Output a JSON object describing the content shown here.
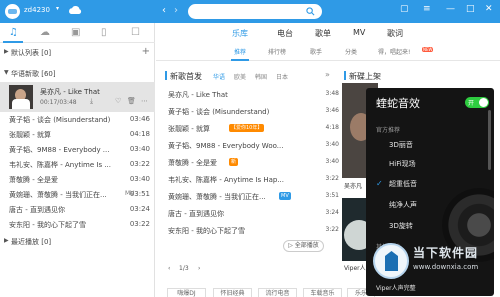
{
  "titlebar": {
    "username": "zd4230",
    "search_placeholder": "",
    "minimize": "—",
    "maximize": "□",
    "close": "✕",
    "skin": "▢",
    "menu": "≡"
  },
  "sidebar": {
    "tab_icons": [
      "music-note",
      "cloud",
      "device",
      "mobile",
      "phone"
    ],
    "groups": {
      "default_list": "默认列表 [0]",
      "hua_yu": "华语新歌 [60]",
      "recent": "最近播放 [0]"
    },
    "now_playing": {
      "title": "吴亦凡 - Like That",
      "time": "00:17/03:48"
    },
    "songs": [
      {
        "name": "黄子韬 - 谈会 (Misunderstand)",
        "duration": "03:46",
        "mv": ""
      },
      {
        "name": "张靓颖 - 就算",
        "duration": "04:18",
        "mv": ""
      },
      {
        "name": "黄子韬、9M88 - Everybody ...",
        "duration": "03:40",
        "mv": ""
      },
      {
        "name": "韦礼安、陈嘉桦 - Anytime Is ...",
        "duration": "03:22",
        "mv": ""
      },
      {
        "name": "萧敬腾 - 全是爱",
        "duration": "03:40",
        "mv": ""
      },
      {
        "name": "黄婉珊、萧敬腾 - 当我们正在...",
        "duration": "03:51",
        "mv": "MV"
      },
      {
        "name": "唐古 - 直到遇见你",
        "duration": "03:24",
        "mv": ""
      },
      {
        "name": "安东阳 - 我的心下起了雪",
        "duration": "03:22",
        "mv": ""
      }
    ]
  },
  "main": {
    "top_tabs": [
      "乐库",
      "电台",
      "歌单",
      "MV",
      "歌词"
    ],
    "sub_tabs": [
      "推荐",
      "排行榜",
      "歌手",
      "分类",
      "得，唱起来!"
    ],
    "new_badge": "NEW",
    "section_new": "新歌首发",
    "section_upcoming": "新碟上架",
    "filters": [
      "华语",
      "欧美",
      "韩国",
      "日本"
    ],
    "songs": [
      {
        "name": "吴亦凡 - Like That",
        "duration": "3:48",
        "tag": ""
      },
      {
        "name": "黄子韬 - 谈会 (Misunderstand)",
        "duration": "3:46",
        "tag": ""
      },
      {
        "name": "张靓颖 - 就算",
        "duration": "4:18",
        "tag": "【爱你10年】"
      },
      {
        "name": "黄子韬、9M88 - Everybody Woo...",
        "duration": "3:40",
        "tag": ""
      },
      {
        "name": "萧敬腾 - 全是爱",
        "duration": "3:40",
        "tag": "新"
      },
      {
        "name": "韦礼安、陈嘉桦 - Anytime Is Hap...",
        "duration": "3:22",
        "tag": ""
      },
      {
        "name": "黄婉珊、萧敬腾 - 当我们正在...",
        "duration": "3:51",
        "tag": "MV"
      },
      {
        "name": "唐古 - 直到遇见你",
        "duration": "3:24",
        "tag": ""
      },
      {
        "name": "安东阳 - 我的心下起了雪",
        "duration": "3:22",
        "tag": ""
      }
    ],
    "pager": {
      "prev": "‹",
      "label": "1/3",
      "next": "›"
    },
    "play_all": "▷ 全部播放",
    "chips": [
      "嗨爆DJ",
      "怀旧经典",
      "流行电音",
      "车载音乐",
      "乐乐"
    ],
    "thumb_labels": [
      "吴亦凡",
      "Viper人声完整"
    ]
  },
  "effects_panel": {
    "title": "蝰蛇音效",
    "toggle": "开",
    "section_recommended": "官方推荐",
    "options": [
      {
        "label": "3D丽音",
        "selected": false
      },
      {
        "label": "HiFi现场",
        "selected": false
      },
      {
        "label": "超重低音",
        "selected": true
      },
      {
        "label": "纯净人声",
        "selected": false
      },
      {
        "label": "3D旋转",
        "selected": false
      }
    ],
    "section_custom": "其他音效",
    "bottom": "Viper人声完整"
  },
  "watermark": {
    "brand": "当下软件园",
    "url": "www.downxia.com"
  }
}
